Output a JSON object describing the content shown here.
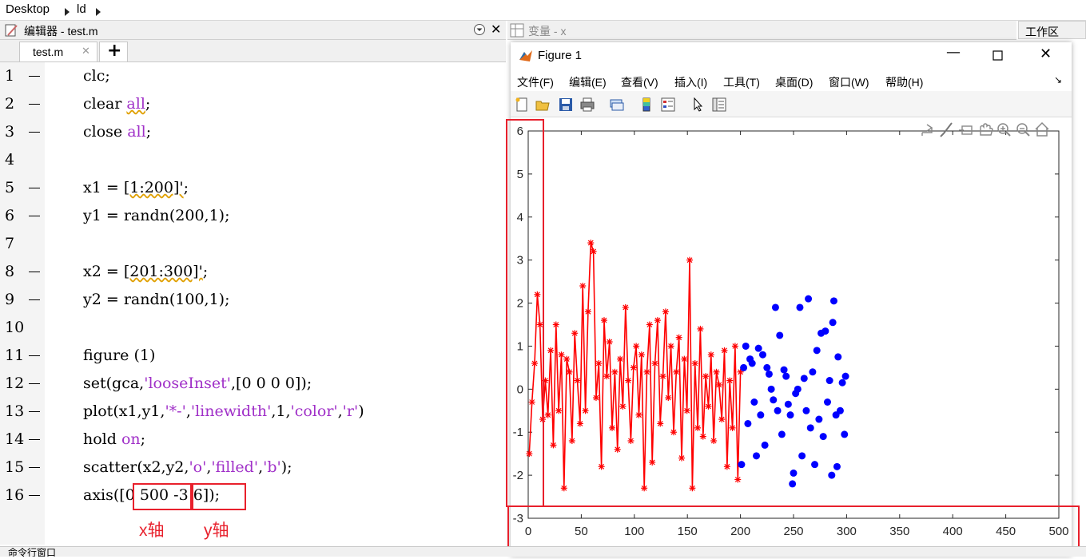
{
  "breadcrumb": {
    "items": [
      "Desktop",
      "ld"
    ]
  },
  "editor": {
    "panel_title": "编辑器 - test.m",
    "tab_label": "test.m",
    "add_tab": "+",
    "line_numbers": [
      "1",
      "2",
      "3",
      "4",
      "5",
      "6",
      "7",
      "8",
      "9",
      "10",
      "11",
      "12",
      "13",
      "14",
      "15",
      "16"
    ],
    "lines": {
      "l1": "clc;",
      "l2a": "clear ",
      "l2b": "all",
      "l2c": ";",
      "l3a": "close ",
      "l3b": "all",
      "l3c": ";",
      "l5a": "x1 = ",
      "l5b": "[1:200]'",
      "l5c": ";",
      "l6": "y1 = randn(200,1);",
      "l8a": "x2 = ",
      "l8b": "[201:300]'",
      "l8c": ";",
      "l9": "y2 = randn(100,1);",
      "l11": "figure (1)",
      "l12a": "set(gca,",
      "l12b": "'looseInset'",
      "l12c": ",[0 0 0 0]);",
      "l13a": "plot(x1,y1,",
      "l13b": "'*-'",
      "l13c": ",",
      "l13d": "'linewidth'",
      "l13e": ",1,",
      "l13f": "'color'",
      "l13g": ",",
      "l13h": "'r'",
      "l13i": ")",
      "l14a": "hold ",
      "l14b": "on",
      "l14c": ";",
      "l15a": "scatter(x2,y2,",
      "l15b": "'o'",
      "l15c": ",",
      "l15d": "'filled'",
      "l15e": ",",
      "l15f": "'b'",
      "l15g": ");",
      "l16a": "axis(",
      "l16b": "[0 500",
      "l16c": " -3 6]",
      "l16d": ");"
    },
    "annotation_x": "x轴",
    "annotation_y": "y轴"
  },
  "variables_panel": {
    "title": "变量 - x"
  },
  "workspace_panel": {
    "title": "工作区"
  },
  "figure": {
    "title": "Figure 1",
    "menus": [
      "文件(F)",
      "编辑(E)",
      "查看(V)",
      "插入(I)",
      "工具(T)",
      "桌面(D)",
      "窗口(W)",
      "帮助(H)"
    ],
    "toolbar_icons": [
      "new-figure-icon",
      "open-icon",
      "save-icon",
      "print-icon",
      "link-icon",
      "colorbar-icon",
      "legend-icon",
      "pointer-icon",
      "property-editor-icon"
    ],
    "axes_toolbar_icons": [
      "export-icon",
      "brush-icon",
      "datatip-icon",
      "pan-icon",
      "zoom-in-icon",
      "zoom-out-icon",
      "home-icon"
    ]
  },
  "command_window": {
    "title": "命令行窗口"
  },
  "colors": {
    "line": "#ff0000",
    "scatter": "#0000ff",
    "annotation": "#e8202c"
  },
  "chart_data": {
    "type": "line+scatter",
    "xlim": [
      0,
      500
    ],
    "ylim": [
      -3,
      6
    ],
    "xticks": [
      "0",
      "50",
      "100",
      "150",
      "200",
      "250",
      "300",
      "350",
      "400",
      "450",
      "500"
    ],
    "yticks": [
      "-3",
      "-2",
      "-1",
      "0",
      "1",
      "2",
      "3",
      "4",
      "5",
      "6"
    ],
    "series": [
      {
        "style": "line with asterisk markers",
        "color": "#ff0000",
        "x_range": [
          1,
          200
        ],
        "y_sample": [
          -1.5,
          -0.3,
          0.6,
          2.2,
          1.5,
          -0.7,
          0.2,
          -0.6,
          0.9,
          -1.3,
          1.5,
          -0.5,
          0.8,
          -2.3,
          0.7,
          0.4,
          -1.2,
          1.3,
          0.2,
          -0.8,
          2.4,
          -0.5,
          1.8,
          3.4,
          3.2,
          -0.2,
          0.6,
          -1.8,
          1.6,
          0.3,
          1.1,
          -0.9,
          0.4,
          -1.4,
          0.7,
          -0.4,
          1.9,
          0.2,
          -1.2,
          0.5,
          1.0,
          -0.6,
          0.8,
          -2.3,
          0.4,
          1.5,
          -1.7,
          0.6,
          1.6,
          -0.8,
          0.3,
          1.8,
          -0.2,
          1.0,
          -1.0,
          0.4,
          1.2,
          -1.6,
          0.7,
          -0.5,
          3.0,
          -2.3,
          0.6,
          -0.9,
          1.4,
          -1.1,
          0.3,
          -0.4,
          0.8,
          -1.2,
          0.4,
          0.1,
          -0.7,
          0.9,
          -1.8,
          0.2,
          -0.9,
          1.0,
          -2.1,
          0.4
        ]
      },
      {
        "style": "filled circles",
        "color": "#0000ff",
        "x_range": [
          201,
          300
        ],
        "points": [
          [
            201,
            -1.75
          ],
          [
            203,
            0.5
          ],
          [
            205,
            1.0
          ],
          [
            207,
            -0.8
          ],
          [
            209,
            0.7
          ],
          [
            211,
            0.6
          ],
          [
            213,
            -0.3
          ],
          [
            215,
            -1.55
          ],
          [
            217,
            0.95
          ],
          [
            219,
            -0.6
          ],
          [
            221,
            0.8
          ],
          [
            223,
            -1.3
          ],
          [
            225,
            0.5
          ],
          [
            227,
            0.35
          ],
          [
            229,
            0.0
          ],
          [
            231,
            -0.25
          ],
          [
            233,
            1.9
          ],
          [
            235,
            -0.5
          ],
          [
            237,
            1.25
          ],
          [
            239,
            -1.05
          ],
          [
            241,
            0.45
          ],
          [
            243,
            0.3
          ],
          [
            245,
            -0.35
          ],
          [
            247,
            -0.6
          ],
          [
            249,
            -2.2
          ],
          [
            250,
            -1.95
          ],
          [
            252,
            -0.1
          ],
          [
            254,
            0.0
          ],
          [
            256,
            1.9
          ],
          [
            258,
            -1.55
          ],
          [
            260,
            0.25
          ],
          [
            262,
            -0.5
          ],
          [
            264,
            2.1
          ],
          [
            266,
            -0.9
          ],
          [
            268,
            0.4
          ],
          [
            270,
            -1.75
          ],
          [
            272,
            0.9
          ],
          [
            274,
            -0.7
          ],
          [
            276,
            1.3
          ],
          [
            278,
            -1.1
          ],
          [
            280,
            1.35
          ],
          [
            282,
            -0.3
          ],
          [
            284,
            0.2
          ],
          [
            286,
            -2.0
          ],
          [
            287,
            1.55
          ],
          [
            288,
            2.05
          ],
          [
            290,
            -0.6
          ],
          [
            291,
            -1.8
          ],
          [
            292,
            0.75
          ],
          [
            294,
            -0.5
          ],
          [
            296,
            0.15
          ],
          [
            298,
            -1.05
          ],
          [
            299,
            0.3
          ]
        ]
      }
    ]
  }
}
